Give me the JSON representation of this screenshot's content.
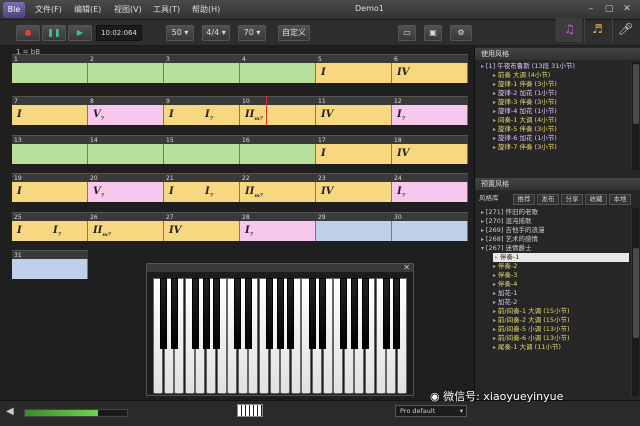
{
  "app": {
    "logo_text": "Ble",
    "window_title": "Demo1"
  },
  "menu": [
    "文件(F)",
    "编辑(E)",
    "视图(V)",
    "工具(T)",
    "帮助(H)"
  ],
  "toolbar": {
    "time": "10:02:064",
    "bpm": "50",
    "meter": "4/4",
    "tempo": "70",
    "custom_label": "自定义"
  },
  "track_header": "1 = bB",
  "rows": [
    {
      "cells": [
        {
          "n": "1",
          "color": "#b8e09a",
          "chords": []
        },
        {
          "n": "2",
          "color": "#b8e09a",
          "chords": []
        },
        {
          "n": "3",
          "color": "#b8e09a",
          "chords": []
        },
        {
          "n": "4",
          "color": "#b8e09a",
          "chords": []
        },
        {
          "n": "5",
          "color": "#f7d880",
          "chords": [
            {
              "t": "I"
            }
          ]
        },
        {
          "n": "6",
          "color": "#f7d880",
          "chords": [
            {
              "t": "IV"
            }
          ]
        }
      ]
    },
    {
      "cells": [
        {
          "n": "7",
          "color": "#f7d880",
          "chords": [
            {
              "t": "I"
            }
          ]
        },
        {
          "n": "8",
          "color": "#f8c8ec",
          "chords": [
            {
              "t": "V",
              "s": "7"
            }
          ]
        },
        {
          "n": "9",
          "color": "#f7d880",
          "chords": [
            {
              "t": "I"
            },
            {
              "t": "I",
              "s": "7"
            }
          ]
        },
        {
          "n": "10",
          "color": "#f7d880",
          "chords": [
            {
              "t": "II",
              "s": "m7"
            }
          ]
        },
        {
          "n": "11",
          "color": "#f7d880",
          "chords": [
            {
              "t": "IV"
            }
          ]
        },
        {
          "n": "12",
          "color": "#f8c8ec",
          "chords": [
            {
              "t": "I",
              "s": "7"
            }
          ]
        }
      ]
    },
    {
      "cells": [
        {
          "n": "13",
          "color": "#b8e09a",
          "chords": []
        },
        {
          "n": "14",
          "color": "#b8e09a",
          "chords": []
        },
        {
          "n": "15",
          "color": "#b8e09a",
          "chords": []
        },
        {
          "n": "16",
          "color": "#b8e09a",
          "chords": []
        },
        {
          "n": "17",
          "color": "#f7d880",
          "chords": [
            {
              "t": "I"
            }
          ]
        },
        {
          "n": "18",
          "color": "#f7d880",
          "chords": [
            {
              "t": "IV"
            }
          ]
        }
      ]
    },
    {
      "cells": [
        {
          "n": "19",
          "color": "#f7d880",
          "chords": [
            {
              "t": "I"
            }
          ]
        },
        {
          "n": "20",
          "color": "#f8c8ec",
          "chords": [
            {
              "t": "V",
              "s": "7"
            }
          ]
        },
        {
          "n": "21",
          "color": "#f7d880",
          "chords": [
            {
              "t": "I"
            },
            {
              "t": "I",
              "s": "7"
            }
          ]
        },
        {
          "n": "22",
          "color": "#f7d880",
          "chords": [
            {
              "t": "II",
              "s": "m7"
            }
          ]
        },
        {
          "n": "23",
          "color": "#f7d880",
          "chords": [
            {
              "t": "IV"
            }
          ]
        },
        {
          "n": "24",
          "color": "#f8c8ec",
          "chords": [
            {
              "t": "I",
              "s": "7"
            }
          ]
        }
      ]
    },
    {
      "cells": [
        {
          "n": "25",
          "color": "#f7d880",
          "chords": [
            {
              "t": "I"
            },
            {
              "t": "I",
              "s": "7"
            }
          ]
        },
        {
          "n": "26",
          "color": "#f7d880",
          "chords": [
            {
              "t": "II",
              "s": "m7"
            }
          ]
        },
        {
          "n": "27",
          "color": "#f7d880",
          "chords": [
            {
              "t": "IV"
            }
          ]
        },
        {
          "n": "28",
          "color": "#f8c8ec",
          "chords": [
            {
              "t": "I",
              "s": "7"
            }
          ]
        },
        {
          "n": "29",
          "color": "#c0d0e8",
          "chords": []
        },
        {
          "n": "30",
          "color": "#c0d0e8",
          "chords": []
        }
      ]
    },
    {
      "cells": [
        {
          "n": "31",
          "color": "#c0d0e8",
          "chords": []
        }
      ]
    }
  ],
  "right_panel": {
    "used_styles_title": "使用风格",
    "used_styles": [
      {
        "text": "[1] 午夜布鲁斯 (13段 31小节)",
        "cls": "lav",
        "indent": 0
      },
      {
        "text": "前奏 大调 (4小节)",
        "cls": "yellow",
        "indent": 1
      },
      {
        "text": "旋律-1 伴奏 (3小节)",
        "cls": "yellow",
        "indent": 1
      },
      {
        "text": "旋律-2 加花 (1小节)",
        "cls": "lav",
        "indent": 1
      },
      {
        "text": "旋律-3 伴奏 (3小节)",
        "cls": "yellow",
        "indent": 1
      },
      {
        "text": "旋律-4 加花 (1小节)",
        "cls": "lav",
        "indent": 1
      },
      {
        "text": "间奏-1 大调 (4小节)",
        "cls": "yellow",
        "indent": 1
      },
      {
        "text": "旋律-5 伴奏 (3小节)",
        "cls": "yellow",
        "indent": 1
      },
      {
        "text": "旋律-6 加花 (1小节)",
        "cls": "lav",
        "indent": 1
      },
      {
        "text": "旋律-7 伴奏 (3小节)",
        "cls": "yellow",
        "indent": 1
      }
    ],
    "preset_title": "预置风格",
    "filter_tabs": [
      "风格库",
      "推荐",
      "发布",
      "分享",
      "收藏",
      "本地"
    ],
    "preset_styles": [
      {
        "text": "[271] 怀旧的老歌",
        "cls": "plain",
        "indent": 0
      },
      {
        "text": "[270] 混沌摇歌",
        "cls": "plain",
        "indent": 0
      },
      {
        "text": "[269] 吉他手的浪漫",
        "cls": "plain",
        "indent": 0
      },
      {
        "text": "[268] 艺术的感情",
        "cls": "plain",
        "indent": 0
      },
      {
        "text": "[267] 迷情爵士",
        "cls": "plain",
        "indent": 0,
        "open": true
      },
      {
        "text": "伴奏-1",
        "cls": "selected",
        "indent": 1
      },
      {
        "text": "伴奏-2",
        "cls": "yellow",
        "indent": 1
      },
      {
        "text": "伴奏-3",
        "cls": "yellow",
        "indent": 1
      },
      {
        "text": "伴奏-4",
        "cls": "yellow",
        "indent": 1
      },
      {
        "text": "加花-1",
        "cls": "lav",
        "indent": 1
      },
      {
        "text": "加花-2",
        "cls": "lav",
        "indent": 1
      },
      {
        "text": "前/间奏-1 大调 (15小节)",
        "cls": "yellow",
        "indent": 1
      },
      {
        "text": "前/间奏-2 大调 (15小节)",
        "cls": "yellow",
        "indent": 1
      },
      {
        "text": "前/间奏-5 小调 (13小节)",
        "cls": "yellow",
        "indent": 1
      },
      {
        "text": "前/间奏-6 小调 (13小节)",
        "cls": "yellow",
        "indent": 1
      },
      {
        "text": "尾奏-1 大调 (11小节)",
        "cls": "yellow",
        "indent": 1
      }
    ]
  },
  "status": {
    "instrument": "Pro default",
    "volume_fraction": 0.72
  },
  "watermark": "微信号: xiaoyueyinyue"
}
